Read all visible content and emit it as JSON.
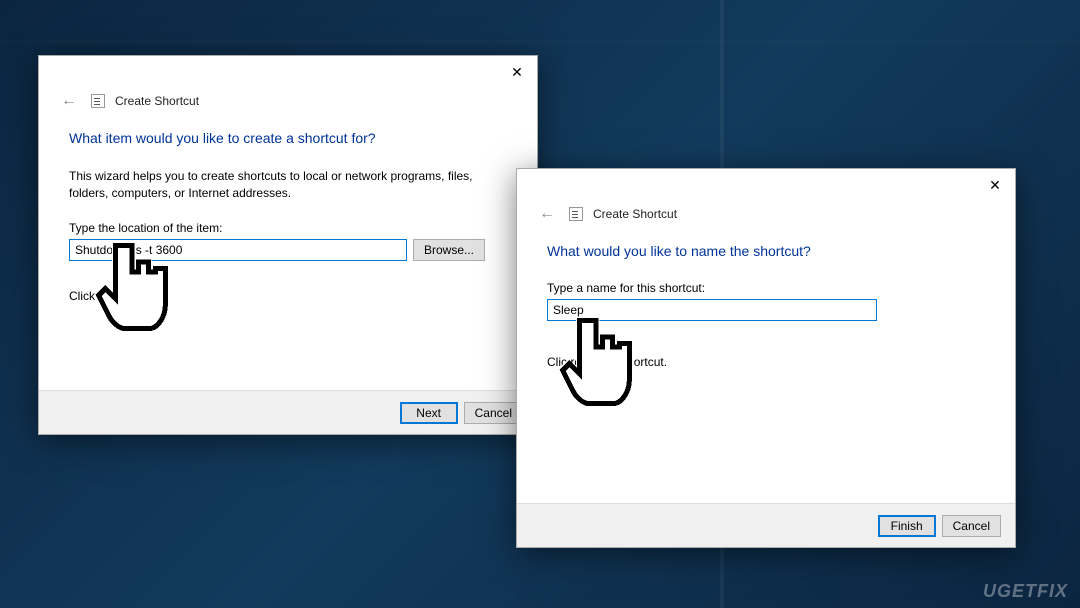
{
  "dialog1": {
    "title": "Create Shortcut",
    "heading": "What item would you like to create a shortcut for?",
    "description": "This wizard helps you to create shortcuts to local or network programs, files, folders, computers, or Internet addresses.",
    "field_label": "Type the location of the item:",
    "location_value": "Shutdown -s -t 3600",
    "browse_label": "Browse...",
    "helper_text_partial": "Click Ne                ue.",
    "next_label": "Next",
    "cancel_label": "Cancel"
  },
  "dialog2": {
    "title": "Create Shortcut",
    "heading": "What would you like to name the shortcut?",
    "field_label": "Type a name for this shortcut:",
    "name_value": "Sleep",
    "helper_text_partial": "Clic                reate the shortcut.",
    "finish_label": "Finish",
    "cancel_label": "Cancel"
  },
  "watermark": "UGETFIX"
}
